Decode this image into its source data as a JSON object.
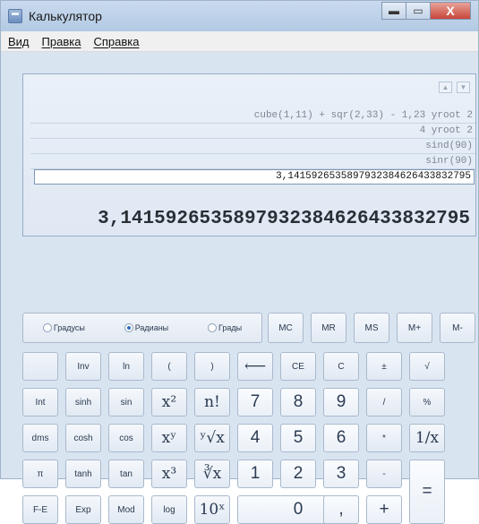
{
  "window": {
    "title": "Калькулятор",
    "controls": {
      "minimize": "▬",
      "maximize": "▭",
      "close": "X"
    }
  },
  "menu": [
    "Вид",
    "Правка",
    "Справка"
  ],
  "display": {
    "history": [
      "cube(1,11) + sqr(2,33) - 1,23 yroot 2",
      "4 yroot 2",
      "sind(90)",
      "sinr(90)"
    ],
    "input": "3,1415926535897932384626433832795",
    "value": "3,1415926535897932384626433832795",
    "scroll_up": "▲",
    "scroll_down": "▼"
  },
  "angle_units": {
    "options": [
      "Градусы",
      "Радианы",
      "Грады"
    ],
    "selected": "Радианы"
  },
  "memory": [
    "MC",
    "MR",
    "MS",
    "M+",
    "M-"
  ],
  "buttons": {
    "inv": "Inv",
    "ln": "ln",
    "lparen": "(",
    "rparen": ")",
    "back": "⟵",
    "ce": "CE",
    "c": "C",
    "plusminus": "±",
    "sqrt": "√",
    "int": "Int",
    "sinh": "sinh",
    "sin": "sin",
    "x2": "x²",
    "fact": "n!",
    "n7": "7",
    "n8": "8",
    "n9": "9",
    "divide": "/",
    "percent": "%",
    "dms": "dms",
    "cosh": "cosh",
    "cos": "cos",
    "xy": "xʸ",
    "yroot": "ʸ√x",
    "n4": "4",
    "n5": "5",
    "n6": "6",
    "multiply": "*",
    "recip": "1/x",
    "pi": "π",
    "tanh": "tanh",
    "tan": "tan",
    "x3": "x³",
    "cuberoot": "∛x",
    "n1": "1",
    "n2": "2",
    "n3": "3",
    "minus": "-",
    "equals": "=",
    "fe": "F-E",
    "exp": "Exp",
    "mod": "Mod",
    "log": "log",
    "pow10": "10ˣ",
    "n0": "0",
    "decimal": ",",
    "plus": "+"
  }
}
